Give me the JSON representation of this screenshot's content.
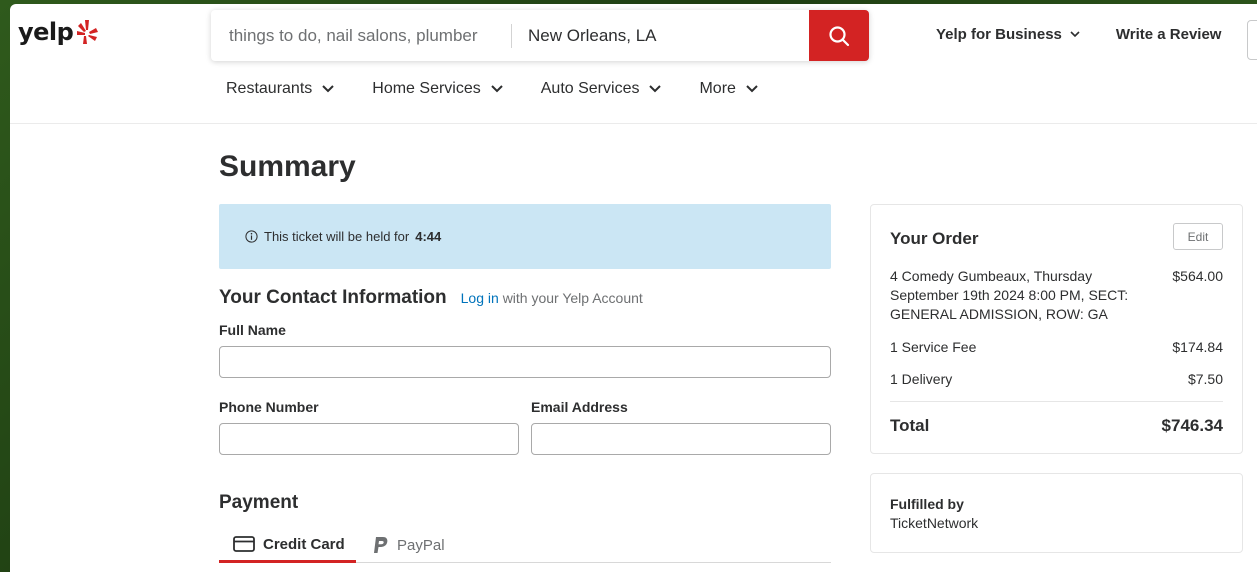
{
  "header": {
    "logo_text": "yelp",
    "search": {
      "find_placeholder": "things to do, nail salons, plumber",
      "near_value": "New Orleans, LA"
    },
    "nav": {
      "business_label": "Yelp for Business",
      "write_review_label": "Write a Review"
    },
    "categories": [
      {
        "label": "Restaurants"
      },
      {
        "label": "Home Services"
      },
      {
        "label": "Auto Services"
      },
      {
        "label": "More"
      }
    ]
  },
  "main": {
    "title": "Summary",
    "hold_notice": {
      "text": "This ticket will be held for",
      "time": "4:44"
    },
    "contact": {
      "heading": "Your Contact Information",
      "login_link": "Log in",
      "login_suffix": "with your Yelp Account",
      "full_name_label": "Full Name",
      "full_name_value": "",
      "phone_label": "Phone Number",
      "phone_value": "",
      "email_label": "Email Address",
      "email_value": ""
    },
    "payment": {
      "heading": "Payment",
      "tabs": [
        {
          "label": "Credit Card",
          "active": true
        },
        {
          "label": "PayPal",
          "active": false
        }
      ]
    }
  },
  "order": {
    "heading": "Your Order",
    "edit_label": "Edit",
    "items": [
      {
        "desc": "4 Comedy Gumbeaux, Thursday September 19th 2024 8:00 PM, SECT: GENERAL ADMISSION, ROW: GA",
        "price": "$564.00"
      },
      {
        "desc": "1 Service Fee",
        "price": "$174.84"
      },
      {
        "desc": "1 Delivery",
        "price": "$7.50"
      }
    ],
    "total_label": "Total",
    "total_value": "$746.34"
  },
  "fulfillment": {
    "label": "Fulfilled by",
    "value": "TicketNetwork"
  },
  "colors": {
    "brand_red": "#d32323",
    "link_blue": "#0073bb",
    "notice_bg": "#cbe6f4"
  }
}
